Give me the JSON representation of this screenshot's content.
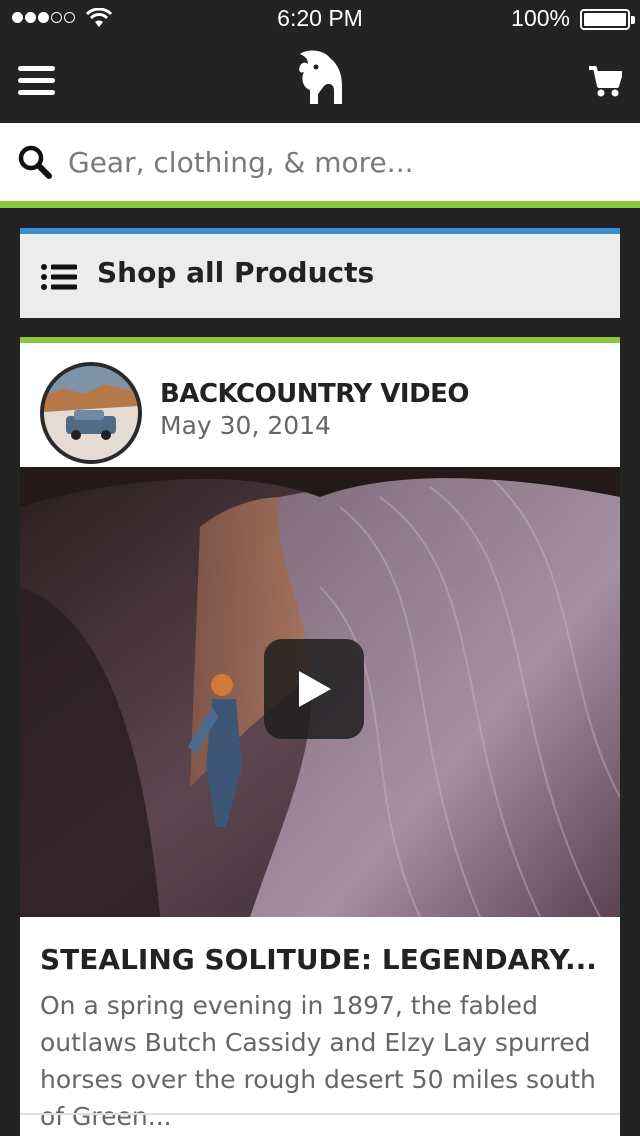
{
  "status_bar": {
    "time": "6:20 PM",
    "battery": "100%",
    "battery_level": 1.0,
    "signal_bars_filled": 3,
    "signal_bars_total": 5
  },
  "nav": {
    "menu_icon": "hamburger-menu-icon",
    "logo_icon": "goat-logo-icon",
    "cart_icon": "shopping-cart-icon"
  },
  "search": {
    "placeholder": "Gear, clothing, & more...",
    "value": "",
    "icon": "search-icon"
  },
  "shop_all": {
    "label": "Shop all Products",
    "icon": "list-icon"
  },
  "feed": [
    {
      "source": "BACKCOUNTRY VIDEO",
      "date": "May 30, 2014",
      "title": "STEALING SOLITUDE: LEGENDARY...",
      "excerpt": "On a spring evening in 1897, the fabled outlaws Butch Cassidy and Elzy Lay spurred horses over the rough desert 50 miles south of Green...",
      "media_icon": "play-icon"
    }
  ],
  "colors": {
    "background": "#232323",
    "accent_green": "#8dc63f",
    "accent_blue": "#3b8fce",
    "card": "#ffffff",
    "shop_bg": "#ececec"
  }
}
